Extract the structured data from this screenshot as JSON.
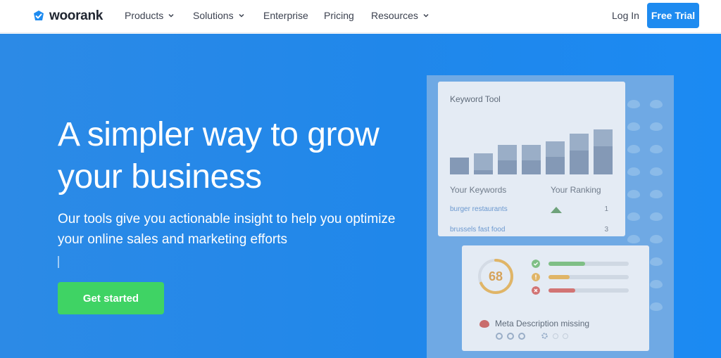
{
  "nav": {
    "logo_text": "woorank",
    "items": [
      {
        "label": "Products",
        "has_dropdown": true
      },
      {
        "label": "Solutions",
        "has_dropdown": true
      },
      {
        "label": "Enterprise",
        "has_dropdown": false
      },
      {
        "label": "Pricing",
        "has_dropdown": false
      },
      {
        "label": "Resources",
        "has_dropdown": true
      }
    ],
    "login_label": "Log In",
    "free_trial_label": "Free Trial"
  },
  "hero": {
    "headline": "A simpler way to grow your business",
    "subtext": "Our tools give you actionable insight to help you optimize your online sales and marketing efforts",
    "cta_label": "Get started"
  },
  "keyword_card": {
    "title": "Keyword Tool",
    "col_keywords": "Your Keywords",
    "col_ranking": "Your Ranking",
    "rows": [
      {
        "keyword": "burger restaurants",
        "rank": "1",
        "trend": "up"
      },
      {
        "keyword": "brussels fast food",
        "rank": "3",
        "trend": ""
      }
    ]
  },
  "score_card": {
    "score": "68",
    "statuses": [
      {
        "type": "pass",
        "fill": 0.46
      },
      {
        "type": "warning",
        "fill": 0.26
      },
      {
        "type": "error",
        "fill": 0.33
      }
    ],
    "issue_text": "Meta Description missing"
  },
  "colors": {
    "brand": "#1e8bf0",
    "cta": "#3fd364",
    "pass": "#7fbf86",
    "warning": "#e0b567",
    "error": "#d27474"
  }
}
